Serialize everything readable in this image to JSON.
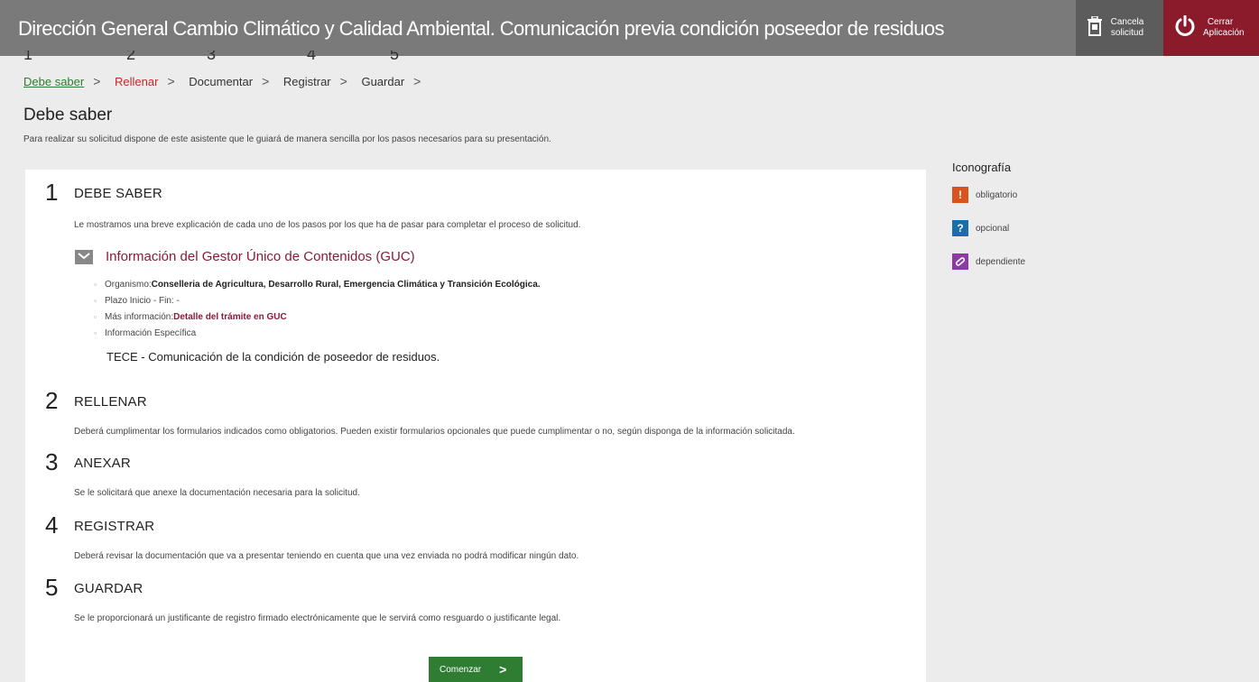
{
  "header": {
    "title": "Dirección General Cambio Climático y Calidad Ambiental. Comunicación previa condición poseedor de residuos",
    "cancel": {
      "label_1": "Cancela",
      "label_2": "solicitud",
      "icon": "trash-icon"
    },
    "close": {
      "label_1": "Cerrar",
      "label_2": "Aplicación",
      "icon": "power-icon"
    }
  },
  "wizard": {
    "step_numbers": [
      "1",
      "2",
      "3",
      "4",
      "5"
    ],
    "steps": [
      {
        "label": "Debe saber",
        "state": "done"
      },
      {
        "label": "Rellenar",
        "state": "current"
      },
      {
        "label": "Documentar",
        "state": "pending"
      },
      {
        "label": "Registrar",
        "state": "pending"
      },
      {
        "label": "Guardar",
        "state": "pending"
      }
    ],
    "separator": ">"
  },
  "page": {
    "title": "Debe saber",
    "subtitle": "Para realizar su solicitud dispone de este asistente que le guiará de manera sencilla por los pasos necesarios para su presentación."
  },
  "content": {
    "steps": [
      {
        "num": "1",
        "title": "DEBE SABER",
        "desc": "Le mostramos una breve explicación de cada uno de los pasos por los que ha de pasar para completar el proceso de solicitud."
      },
      {
        "num": "2",
        "title": "RELLENAR",
        "desc": "Deberá cumplimentar los formularios indicados como obligatorios. Pueden existir formularios opcionales que puede cumplimentar o no, según disponga de la información solicitada."
      },
      {
        "num": "3",
        "title": "ANEXAR",
        "desc": "Se le solicitará que anexe la documentación necesaria para la solicitud."
      },
      {
        "num": "4",
        "title": "REGISTRAR",
        "desc": "Deberá revisar la documentación que va a presentar teniendo en cuenta que una vez enviada no podrá modificar ningún dato."
      },
      {
        "num": "5",
        "title": "GUARDAR",
        "desc": "Se le proporcionará un justificante de registro firmado electrónicamente que le servirá como resguardo o justificante legal."
      }
    ],
    "guc": {
      "title": "Información del Gestor Único de Contenidos (GUC)",
      "organismo_label": "Organismo:",
      "organismo_value": "Conselleria de Agricultura, Desarrollo Rural, Emergencia Climática y Transición Ecológica.",
      "plazo": "Plazo Inicio - Fin: -",
      "mas_info_label": "Más información:",
      "mas_info_link": "Detalle del trámite en GUC",
      "info_especifica": "Información Específica",
      "tece": "TECE - Comunicación de la condición de poseedor de residuos."
    },
    "start_button": "Comenzar",
    "start_arrow": ">"
  },
  "iconografia": {
    "title": "Iconografía",
    "items": [
      {
        "label": "obligatorio",
        "symbol": "!",
        "color": "#d9531e"
      },
      {
        "label": "opcional",
        "symbol": "?",
        "color": "#1b6ea8"
      },
      {
        "label": "dependiente",
        "symbol": "🔗",
        "color": "#8e3aa5"
      }
    ]
  },
  "colors": {
    "header_bg": "#7a7a7a",
    "close_bg": "#8b1a2b",
    "link": "#8b1a3a",
    "done": "#2e7d32",
    "current": "#c62828",
    "button": "#2e7d32"
  }
}
